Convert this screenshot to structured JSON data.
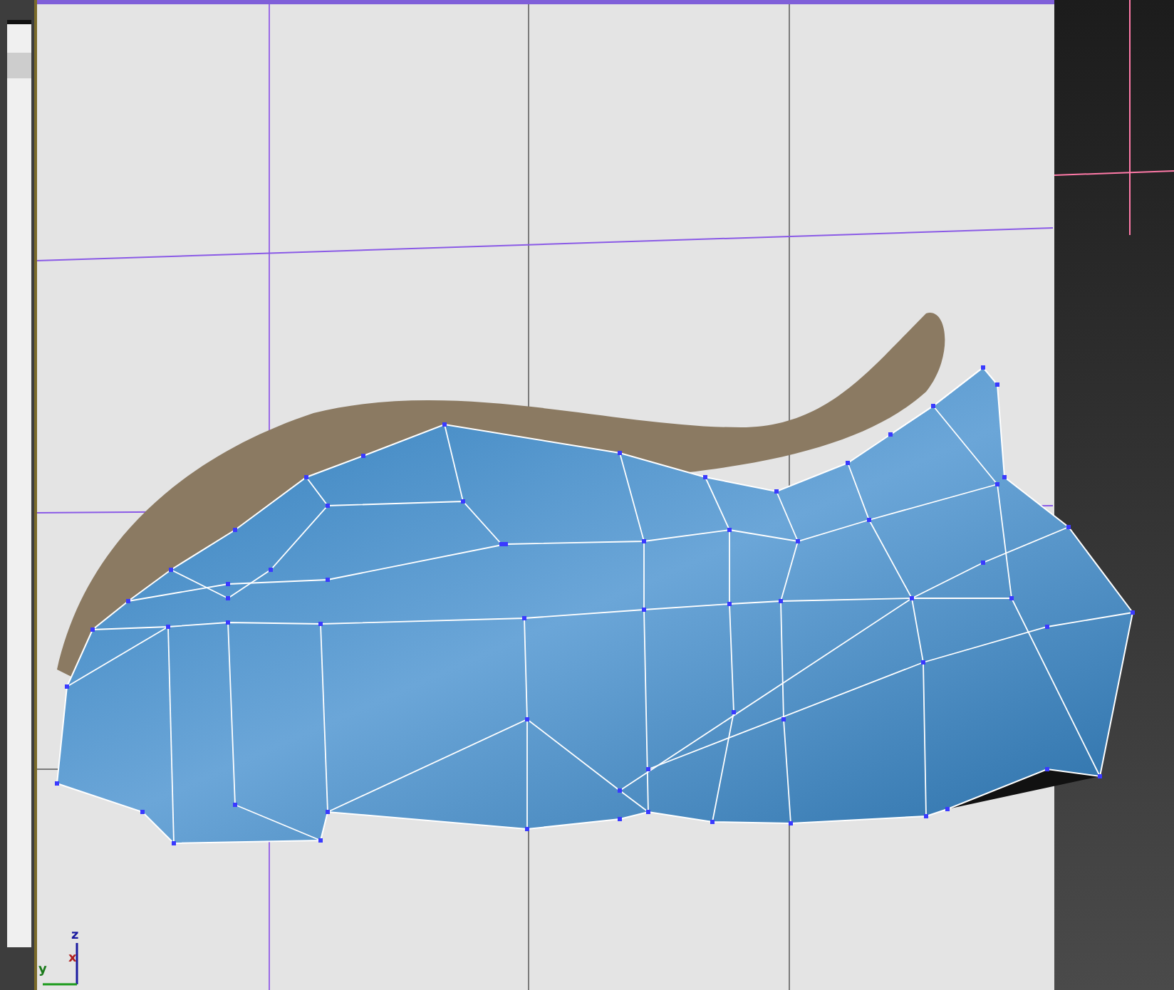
{
  "viewport": {
    "axis_gizmo": [
      {
        "kind": "z",
        "label": "z"
      },
      {
        "kind": "x",
        "label": "x"
      },
      {
        "kind": "y",
        "label": "y"
      }
    ]
  }
}
